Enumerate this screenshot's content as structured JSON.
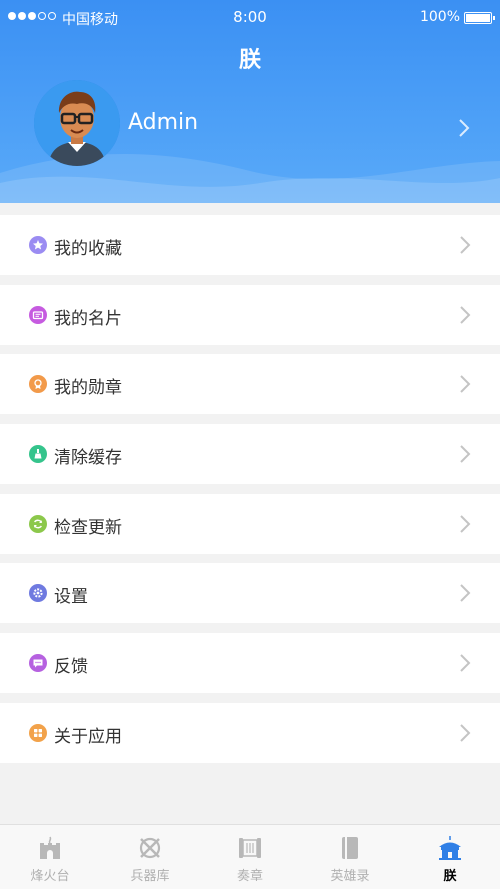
{
  "status_bar": {
    "carrier": "中国移动",
    "time": "8:00",
    "battery": "100%"
  },
  "header": {
    "title": "朕"
  },
  "profile": {
    "name": "Admin"
  },
  "menu": {
    "items": [
      {
        "label": "我的收藏",
        "icon": "star-icon",
        "color": "#9b8cf2"
      },
      {
        "label": "我的名片",
        "icon": "card-icon",
        "color": "#c65be0"
      },
      {
        "label": "我的勋章",
        "icon": "medal-icon",
        "color": "#f29a4a"
      },
      {
        "label": "清除缓存",
        "icon": "broom-icon",
        "color": "#35c48c"
      },
      {
        "label": "检查更新",
        "icon": "refresh-icon",
        "color": "#8cc84b"
      },
      {
        "label": "设置",
        "icon": "gear-icon",
        "color": "#6f7ae0"
      },
      {
        "label": "反馈",
        "icon": "chat-icon",
        "color": "#b661e0"
      },
      {
        "label": "关于应用",
        "icon": "grid-icon",
        "color": "#f2a24a"
      }
    ]
  },
  "tabbar": {
    "tabs": [
      {
        "label": "烽火台",
        "icon": "beacon-tower-icon",
        "active": false
      },
      {
        "label": "兵器库",
        "icon": "weapons-icon",
        "active": false
      },
      {
        "label": "奏章",
        "icon": "scroll-icon",
        "active": false
      },
      {
        "label": "英雄录",
        "icon": "book-icon",
        "active": false
      },
      {
        "label": "朕",
        "icon": "palace-icon",
        "active": true
      }
    ]
  },
  "colors": {
    "header_blue": "#3b90f3",
    "active_tab_blue": "#2f7fe6",
    "inactive_gray": "#b0b0b0"
  }
}
